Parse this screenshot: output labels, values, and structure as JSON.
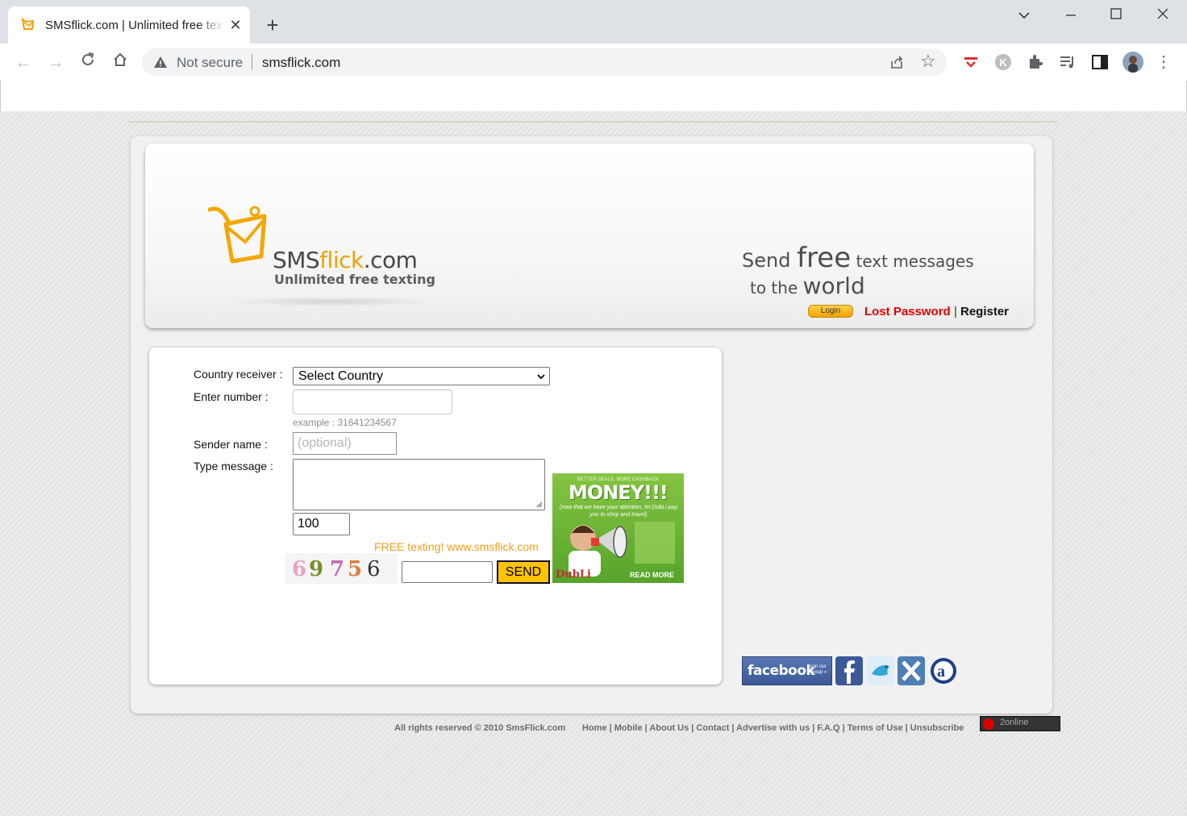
{
  "browser": {
    "tab_title": "SMSflick.com | Unlimited free texting",
    "security_label": "Not secure",
    "url": "smsflick.com"
  },
  "header": {
    "logo_sms": "SMS",
    "logo_flick": "flick",
    "logo_com": ".com",
    "tagline": "Unlimited free texting",
    "slogan_send": "Send ",
    "slogan_free": "free",
    "slogan_text": " text messages",
    "slogan_to": "to the ",
    "slogan_world": "world",
    "login_label": "Login",
    "lost_password": "Lost Password",
    "separator": "|",
    "register": "Register"
  },
  "form": {
    "country_label": "Country receiver :",
    "country_value": "Select Country",
    "number_label": "Enter number :",
    "number_example": "example : 31641234567",
    "sender_label": "Sender name :",
    "sender_placeholder": "(optional)",
    "message_label": "Type message :",
    "char_counter": "100",
    "free_text": "FREE texting! www.smsflick.com",
    "captcha_digits": [
      "6",
      "9",
      "7",
      "5",
      "6"
    ],
    "send_label": "SEND"
  },
  "ad": {
    "top_line": "BETTER DEALS, MORE CASHBACK",
    "headline": "MONEY!!!",
    "subline": "(now that we have your attention, let DubLi pay you to shop and travel)",
    "brand": "DubLi",
    "cta": "READ MORE"
  },
  "social": {
    "facebook_badge": "facebook",
    "facebook_join": "join our group »"
  },
  "footer": {
    "copyright": "All rights reserved © 2010 SmsFlick.com",
    "links": "Home | Mobile | About Us | Contact | Advertise with us | F.A.Q | Terms of Use | Unsubscribe",
    "online_count": "2online"
  },
  "colors": {
    "accent_orange": "#f0a000",
    "lost_password_red": "#e30000",
    "send_button": "#ffc400",
    "free_text_orange": "#f39b1f"
  },
  "icons": [
    "smsflick-favicon",
    "warning-icon",
    "share-icon",
    "star-icon",
    "extension-icons",
    "profile-avatar",
    "facebook-icon",
    "twitter-icon",
    "xing-icon",
    "aim-icon"
  ]
}
